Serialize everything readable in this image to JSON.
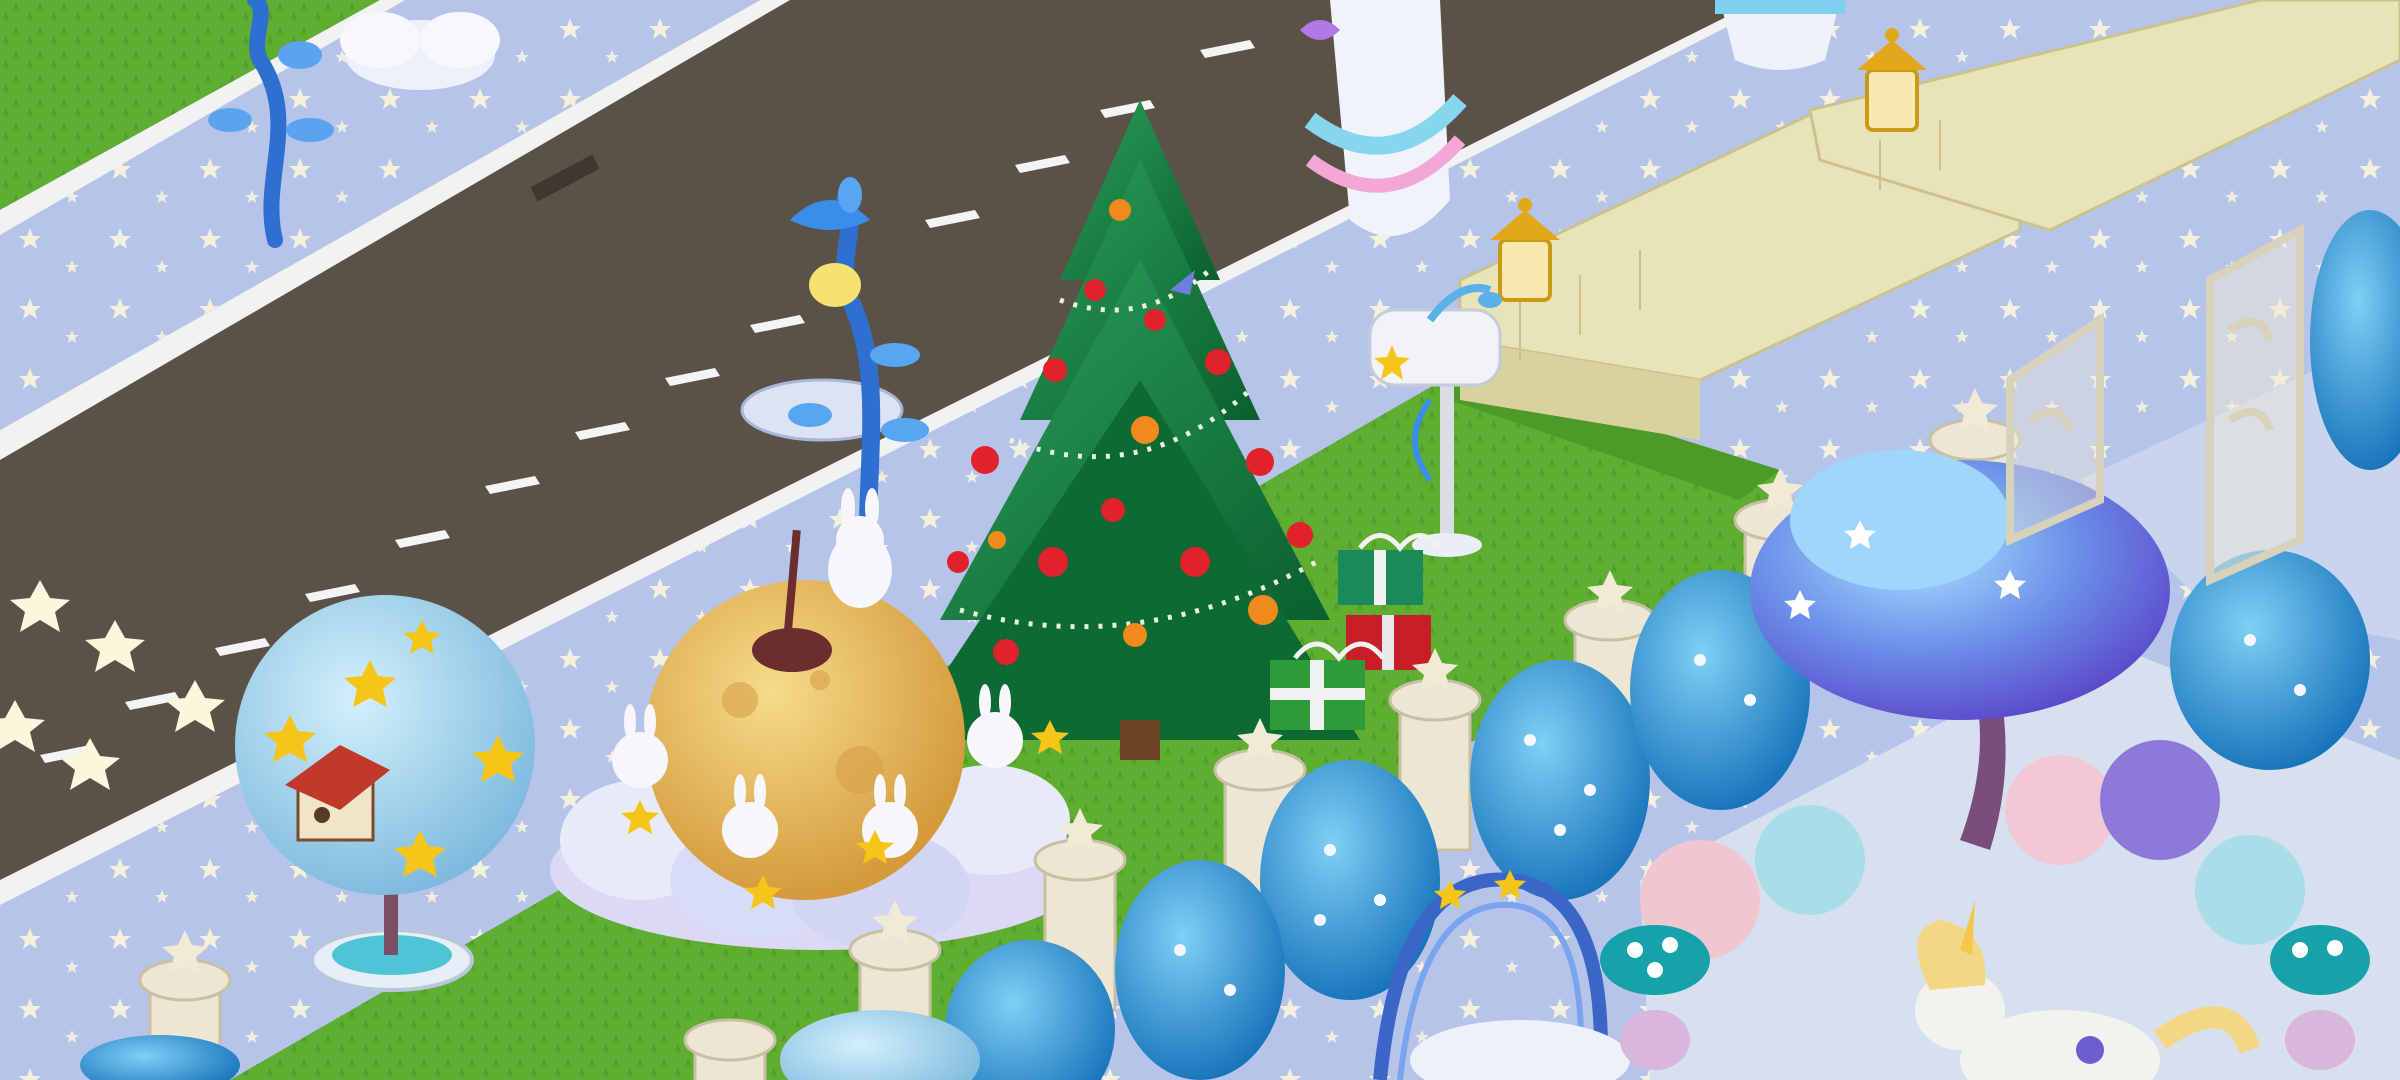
{
  "scene": {
    "view": "isometric-garden",
    "theme": "winter-starry",
    "colors": {
      "grass": "#5fae32",
      "grass_dark": "#3f8a22",
      "road": "#5b5247",
      "road_stripe": "#f4f4f4",
      "sidewalk": "#b7c4ea",
      "sidewalk_star": "#fbf6dc",
      "curb": "#f2f2f2",
      "wall_stone": "#e8e4b7",
      "pine": "#0f7a3b",
      "pine_light": "#2aa05a",
      "ornament_red": "#e0222b",
      "ornament_orange": "#f08a1c",
      "moon": "#e9b95a",
      "cloud": "#e7eaf9",
      "blue_bush": "#1f8fd0",
      "blue_bush_light": "#7fc6ef",
      "purple_tree": "#6b74e6",
      "pond_ice": "#d7e0ef",
      "lantern_gold": "#e3a81a",
      "unicorn_mane": "#f3d784"
    },
    "objects": [
      {
        "id": "christmas-tree",
        "icon": "christmas-tree-icon"
      },
      {
        "id": "gift-boxes",
        "icon": "gift-icon"
      },
      {
        "id": "moon-bunny-decoration",
        "icon": "rabbit-icon"
      },
      {
        "id": "blue-star-topiary",
        "icon": "star-tree-icon"
      },
      {
        "id": "birdhouse",
        "icon": "birdhouse-icon"
      },
      {
        "id": "blue-street-lamp",
        "icon": "lamp-icon"
      },
      {
        "id": "star-mailbox",
        "icon": "mailbox-icon"
      },
      {
        "id": "purple-magic-tree",
        "icon": "tree-icon"
      },
      {
        "id": "unicorn",
        "icon": "unicorn-icon"
      },
      {
        "id": "swirl-pillar",
        "icon": "pillar-icon"
      },
      {
        "id": "garden-lanterns",
        "icon": "lantern-icon"
      },
      {
        "id": "star-fence",
        "icon": "fence-icon"
      },
      {
        "id": "ornate-gate",
        "icon": "gate-icon"
      },
      {
        "id": "cloud-arch",
        "icon": "arch-icon"
      }
    ]
  }
}
